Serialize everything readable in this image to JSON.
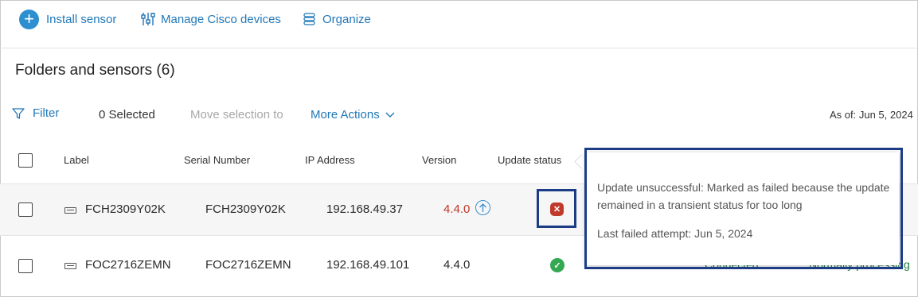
{
  "toolbar": {
    "install_label": "Install sensor",
    "manage_label": "Manage Cisco devices",
    "organize_label": "Organize"
  },
  "section": {
    "title": "Folders and sensors (6)"
  },
  "actions": {
    "filter_label": "Filter",
    "selected_label": "0 Selected",
    "move_label": "Move selection to",
    "more_actions_label": "More Actions",
    "as_of": "As of: Jun 5, 2024"
  },
  "table": {
    "headers": [
      "Label",
      "Serial Number",
      "IP Address",
      "Version",
      "Update status"
    ],
    "rows": [
      {
        "label": "FCH2309Y02K",
        "serial": "FCH2309Y02K",
        "ip": "192.168.49.37",
        "version": "4.4.0",
        "update_status": "failed"
      },
      {
        "label": "FOC2716ZEMN",
        "serial": "FOC2716ZEMN",
        "ip": "192.168.49.101",
        "version": "4.4.0",
        "update_status": "success",
        "connection": "Connected",
        "processing": "Normally processing"
      }
    ]
  },
  "tooltip": {
    "message": "Update unsuccessful: Marked as failed because the update remained in a transient status for too long",
    "last_attempt": "Last failed attempt: Jun 5, 2024"
  },
  "colors": {
    "accent": "#2178b8",
    "error": "#c0392b",
    "success": "#34a853",
    "highlight": "#1c3c86"
  }
}
